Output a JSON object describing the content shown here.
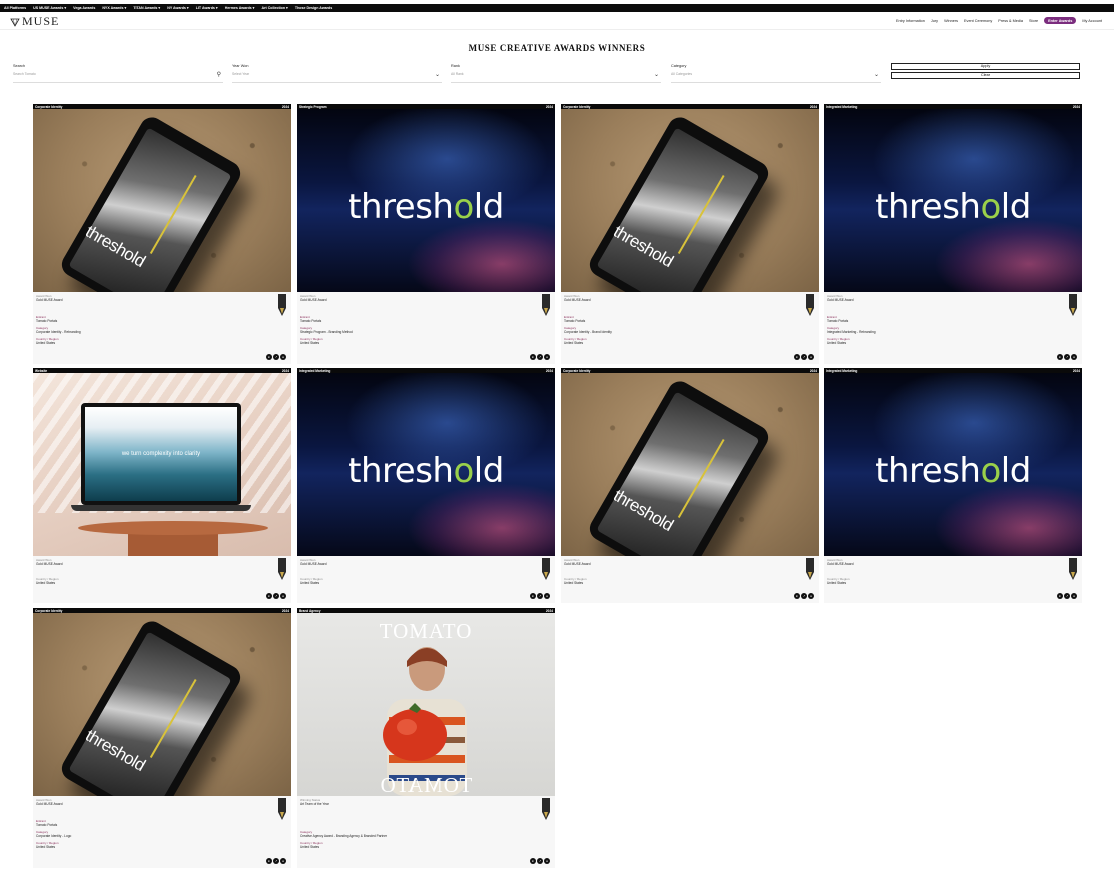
{
  "topbar": {
    "items": [
      "All Platforms",
      "US MUSE Awards ▾",
      "Vega Awards",
      "NYX Awards ▾",
      "TITAN Awards ▾",
      "NY Awards ▾",
      "LIT Awards ▾",
      "Hermes Awards ▾",
      "Art Collection ▾",
      "Those Design Awards"
    ]
  },
  "brand": {
    "logo_text": "MUSE"
  },
  "nav": {
    "items": [
      "Entry Information",
      "Jury",
      "Winners",
      "Event Ceremony",
      "Press & Media",
      "Store"
    ],
    "enter_label": "Enter Awards",
    "account_label": "My Account"
  },
  "page": {
    "title": "MUSE CREATIVE AWARDS WINNERS"
  },
  "filters": {
    "search_label": "Search",
    "search_placeholder": "Search Tomato",
    "year_label": "Year Won",
    "year_placeholder": "Select Year",
    "rank_label": "Rank",
    "rank_placeholder": "All Rank",
    "category_label": "Category",
    "category_placeholder": "All Categories",
    "apply_label": "Apply",
    "clear_label": "Clear"
  },
  "colors": {
    "accent": "#7b2d7e",
    "topbar": "#0c0c0c",
    "label": "#8a2f5a"
  },
  "cards": [
    {
      "category": "Corporate Identity",
      "year": "2024",
      "k1": "Award Won",
      "v1": "Gold MUSE Award",
      "k2": "Entrant",
      "v2": "Tomato Portals",
      "k3": "Category",
      "v3": "Corporate Identity - Rebranding",
      "k4": "Country / Region",
      "v4": "United States"
    },
    {
      "category": "Strategic Program",
      "year": "2024",
      "k1": "Award Won",
      "v1": "Gold MUSE Award",
      "k2": "Entrant",
      "v2": "Tomato Portals",
      "k3": "Category",
      "v3": "Strategic Program - Branding Method",
      "k4": "Country / Region",
      "v4": "United States"
    },
    {
      "category": "Corporate Identity",
      "year": "2024",
      "k1": "Award Won",
      "v1": "Gold MUSE Award",
      "k2": "Entrant",
      "v2": "Tomato Portals",
      "k3": "Category",
      "v3": "Corporate Identity - Brand Identity",
      "k4": "Country / Region",
      "v4": "United States"
    },
    {
      "category": "Integrated Marketing",
      "year": "2024",
      "k1": "Award Won",
      "v1": "Gold MUSE Award",
      "k2": "Entrant",
      "v2": "Tomato Portals",
      "k3": "Category",
      "v3": "Integrated Marketing - Rebranding",
      "k4": "Country / Region",
      "v4": "United States"
    },
    {
      "category": "Website",
      "year": "2024",
      "k1": "Award Won",
      "v1": "Gold MUSE Award",
      "k4": "Country / Region",
      "v4": "United States"
    },
    {
      "category": "Integrated Marketing",
      "year": "2024",
      "k1": "Award Won",
      "v1": "Gold MUSE Award",
      "k4": "Country / Region",
      "v4": "United States"
    },
    {
      "category": "Corporate Identity",
      "year": "2024",
      "k1": "Award Won",
      "v1": "Gold MUSE Award",
      "k4": "Country / Region",
      "v4": "United States"
    },
    {
      "category": "Integrated Marketing",
      "year": "2024",
      "k1": "Award Won",
      "v1": "Gold MUSE Award",
      "k4": "Country / Region",
      "v4": "United States"
    },
    {
      "category": "Corporate Identity",
      "year": "2024",
      "k1": "Award Won",
      "v1": "Gold MUSE Award",
      "k2": "Entrant",
      "v2": "Tomato Portals",
      "k3": "Category",
      "v3": "Corporate Identity - Logo",
      "k4": "Country / Region",
      "v4": "United States"
    },
    {
      "category": "Brand Agency",
      "year": "2024",
      "k1": "Winning Status",
      "v1": "Art Team of the Year",
      "k3": "Category",
      "v3": "Creative Agency Award - Branding Agency & Branded Partner",
      "k4": "Country / Region",
      "v4": "United States"
    }
  ],
  "images": {
    "threshold_word_a": "thresh",
    "threshold_word_l": "o",
    "threshold_word_b": "ld",
    "phone_word": "threshold",
    "laptop_text": "we turn complexity into clarity",
    "tomato_word": "TOMATO"
  }
}
